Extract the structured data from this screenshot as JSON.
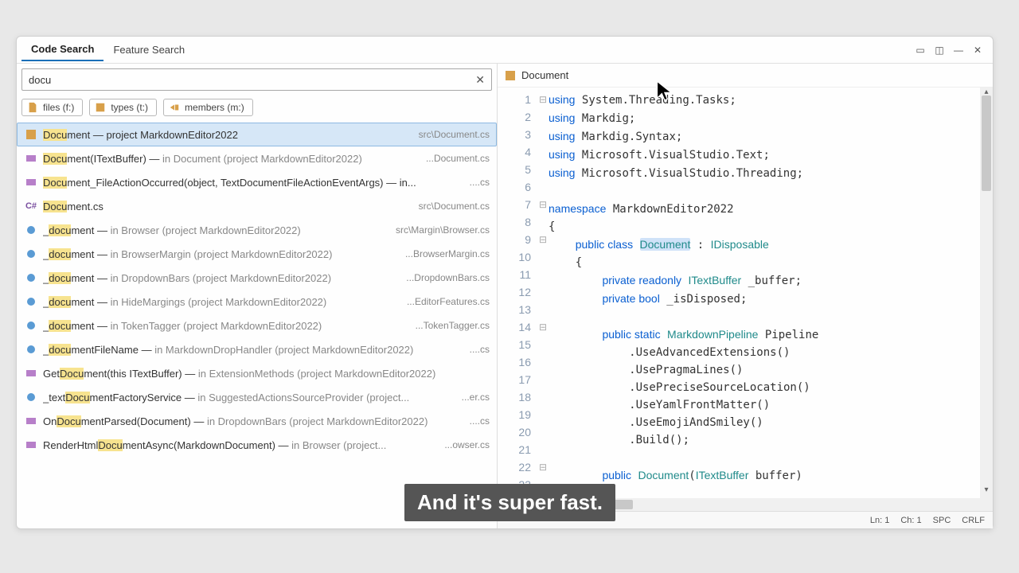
{
  "tabs": {
    "code_search": "Code Search",
    "feature_search": "Feature Search"
  },
  "search": {
    "value": "docu"
  },
  "chips": [
    {
      "label": "files (f:)"
    },
    {
      "label": "types (t:)"
    },
    {
      "label": "members (m:)"
    }
  ],
  "results": [
    {
      "icon": "class",
      "pre": "",
      "hl": "Docu",
      "post": "ment — project MarkdownEditor2022",
      "path": "src\\Document.cs",
      "selected": true
    },
    {
      "icon": "method",
      "pre": "",
      "hl": "Docu",
      "post": "ment(ITextBuffer) — ",
      "sub": "in Document (project MarkdownEditor2022)",
      "path": "...Document.cs"
    },
    {
      "icon": "method",
      "pre": "",
      "hl": "Docu",
      "post": "ment_FileActionOccurred(object, TextDocumentFileActionEventArgs) — in...",
      "path": "....cs"
    },
    {
      "icon": "cs",
      "pre": "",
      "hl": "Docu",
      "post": "ment.cs",
      "path": "src\\Document.cs"
    },
    {
      "icon": "field",
      "pre": "_",
      "hl": "docu",
      "post": "ment — ",
      "sub": "in Browser (project MarkdownEditor2022)",
      "path": "src\\Margin\\Browser.cs"
    },
    {
      "icon": "field",
      "pre": "_",
      "hl": "docu",
      "post": "ment — ",
      "sub": "in BrowserMargin (project MarkdownEditor2022)",
      "path": "...BrowserMargin.cs"
    },
    {
      "icon": "field",
      "pre": "_",
      "hl": "docu",
      "post": "ment — ",
      "sub": "in DropdownBars (project MarkdownEditor2022)",
      "path": "...DropdownBars.cs"
    },
    {
      "icon": "field",
      "pre": "_",
      "hl": "docu",
      "post": "ment — ",
      "sub": "in HideMargings (project MarkdownEditor2022)",
      "path": "...EditorFeatures.cs"
    },
    {
      "icon": "field",
      "pre": "_",
      "hl": "docu",
      "post": "ment — ",
      "sub": "in TokenTagger (project MarkdownEditor2022)",
      "path": "...TokenTagger.cs"
    },
    {
      "icon": "field",
      "pre": "_",
      "hl": "docu",
      "post": "mentFileName — ",
      "sub": "in MarkdownDropHandler (project MarkdownEditor2022)",
      "path": "....cs"
    },
    {
      "icon": "method",
      "pre": "Get",
      "hl": "Docu",
      "post": "ment(this ITextBuffer) — ",
      "sub": "in ExtensionMethods (project MarkdownEditor2022)",
      "path": ""
    },
    {
      "icon": "field",
      "pre": "_text",
      "hl": "Docu",
      "post": "mentFactoryService — ",
      "sub": "in SuggestedActionsSourceProvider (project...",
      "path": "...er.cs"
    },
    {
      "icon": "method",
      "pre": "On",
      "hl": "Docu",
      "post": "mentParsed(Document) — ",
      "sub": "in DropdownBars (project MarkdownEditor2022)",
      "path": "....cs"
    },
    {
      "icon": "method",
      "pre": "RenderHtml",
      "hl": "Docu",
      "post": "mentAsync(MarkdownDocument) — ",
      "sub": "in Browser (project...",
      "path": "...owser.cs"
    }
  ],
  "preview": {
    "title": "Document",
    "lines": [
      1,
      2,
      3,
      4,
      5,
      6,
      7,
      8,
      9,
      10,
      11,
      12,
      13,
      14,
      15,
      16,
      17,
      18,
      19,
      20,
      21,
      22,
      23
    ]
  },
  "status": {
    "ln": "Ln: 1",
    "ch": "Ch: 1",
    "spc": "SPC",
    "crlf": "CRLF"
  },
  "caption": "And it's super fast."
}
